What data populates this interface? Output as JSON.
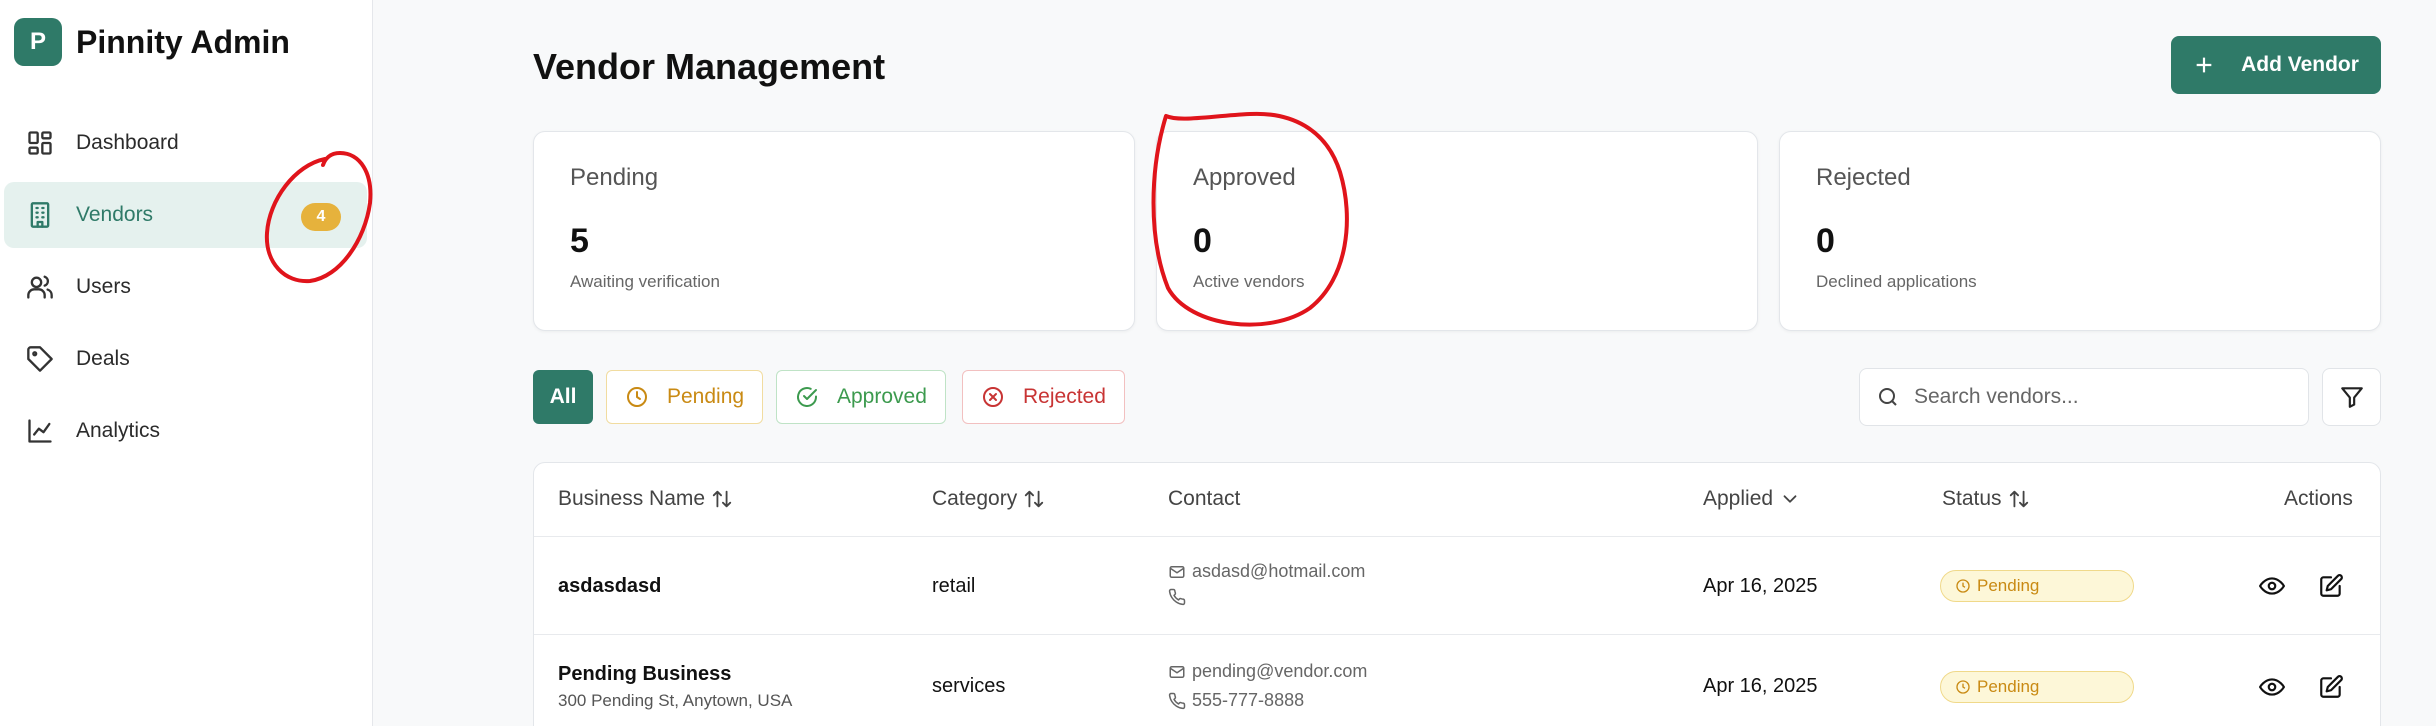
{
  "brand": {
    "logo_letter": "P",
    "name": "Pinnity Admin"
  },
  "sidebar": {
    "items": [
      {
        "label": "Dashboard",
        "icon": "dashboard-icon"
      },
      {
        "label": "Vendors",
        "icon": "building-icon",
        "badge": "4",
        "active": true
      },
      {
        "label": "Users",
        "icon": "users-icon"
      },
      {
        "label": "Deals",
        "icon": "tag-icon"
      },
      {
        "label": "Analytics",
        "icon": "chart-line-icon"
      }
    ]
  },
  "header": {
    "title": "Vendor Management",
    "add_button": "Add Vendor"
  },
  "stats": [
    {
      "label": "Pending",
      "value": "5",
      "sub": "Awaiting verification"
    },
    {
      "label": "Approved",
      "value": "0",
      "sub": "Active vendors"
    },
    {
      "label": "Rejected",
      "value": "0",
      "sub": "Declined applications"
    }
  ],
  "filters": {
    "all": "All",
    "pending": "Pending",
    "approved": "Approved",
    "rejected": "Rejected"
  },
  "search": {
    "placeholder": "Search vendors..."
  },
  "table": {
    "headers": {
      "business_name": "Business Name",
      "category": "Category",
      "contact": "Contact",
      "applied": "Applied",
      "status": "Status",
      "actions": "Actions"
    },
    "rows": [
      {
        "name": "asdasdasd",
        "address": "",
        "category": "retail",
        "email": "asdasd@hotmail.com",
        "phone": "",
        "applied": "Apr 16, 2025",
        "status": "Pending"
      },
      {
        "name": "Pending Business",
        "address": "300 Pending St, Anytown, USA",
        "category": "services",
        "email": "pending@vendor.com",
        "phone": "555-777-8888",
        "applied": "Apr 16, 2025",
        "status": "Pending"
      }
    ]
  },
  "colors": {
    "accent": "#2f7a68",
    "badge": "#e6b23c",
    "pending": "#c98a13",
    "approved": "#3c9a4e",
    "rejected": "#c83434",
    "annotation": "#e0141b"
  }
}
